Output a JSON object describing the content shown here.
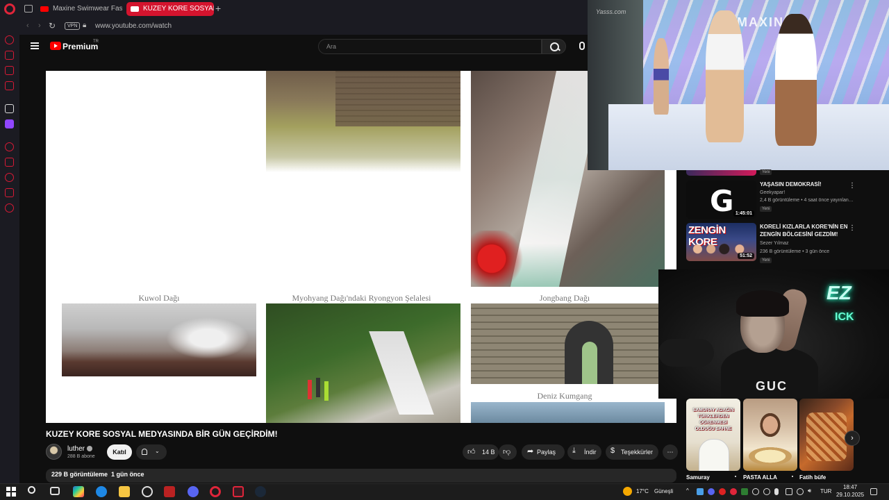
{
  "browser": {
    "tabs": [
      {
        "label": "Maxine Swimwear Fashion"
      },
      {
        "label": "KUZEY KORE SOSYAL"
      }
    ],
    "vpn_label": "VPN",
    "url": "www.youtube.com/watch"
  },
  "youtube": {
    "brand": "Premium",
    "region": "TR",
    "search_placeholder": "Ara"
  },
  "video": {
    "captions": {
      "kuwol": "Kuwol Dağı",
      "ryongyon": "Myohyang Dağı'ndaki Ryongyon Şelalesi",
      "jongbang": "Jongbang Dağı",
      "deniz": "Deniz Kumgang"
    },
    "title": "KUZEY KORE SOSYAL MEDYASINDA BİR GÜN GEÇİRDİM!",
    "channel": "luther",
    "subscribers": "288 B abone",
    "join_label": "Katıl",
    "likes": "14 B",
    "share_label": "Paylaş",
    "download_label": "İndir",
    "thanks_label": "Teşekkürler",
    "views": "229 B görüntüleme",
    "uploaded": "1 gün önce"
  },
  "recommendations": [
    {
      "title": "YAŞASIN DEMOKRASİ!",
      "channel": "Geekyapar!",
      "meta": "2,4 B görüntüleme • 4 saat önce yayınlan…",
      "duration": "1:45:01",
      "badge": "Yeni"
    },
    {
      "title": "KORELİ KIZLARLA KORE'NİN EN ZENGİN BÖLGESİNİ GEZDİM!",
      "channel": "Sezer Yılmaz",
      "meta": "236 B görüntüleme • 3 gün önce",
      "duration": "51:52",
      "badge": "Yeni",
      "thumb_text": "ZENGİN KORE"
    }
  ],
  "partial_rec_badge": "Yeni",
  "overlay_stream": {
    "brand": "MAXIN",
    "watermark": "Yasss.com"
  },
  "webcam": {
    "neon_top": "EZ",
    "neon_bottom": "ICK",
    "shirt": "GUC"
  },
  "shorts": [
    {
      "title": "Samuray",
      "thumb_text": "SAMURAY ADAĞIN TÜRKLERDEN ÖĞRENMESİ OLDUĞU SAHNE"
    },
    {
      "title": "PASTA ALLA"
    },
    {
      "title": "Fatih büfe"
    }
  ],
  "taskbar": {
    "weather": "17°C",
    "weather_label": "Güneşli",
    "language": "TUR",
    "time": "18:47",
    "date": "29.10.2025"
  },
  "colors": {
    "opera_red": "#e0253a",
    "youtube_red": "#ff0000",
    "yt_bg": "#0f0f0f",
    "active_tab": "#d4142e"
  }
}
